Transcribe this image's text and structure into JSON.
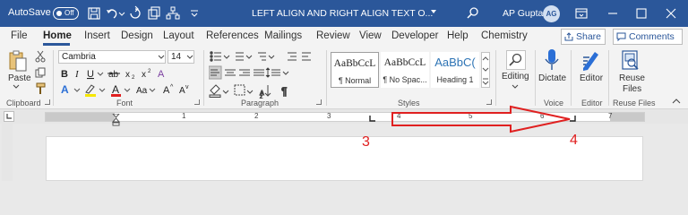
{
  "titlebar": {
    "autosave_label": "AutoSave",
    "autosave_state": "Off",
    "doc_title": "LEFT ALIGN AND RIGHT ALIGN TEXT O...",
    "user_name": "AP Gupta",
    "user_initials": "AG",
    "bar_color": "#2b579a"
  },
  "tabs": [
    "File",
    "Home",
    "Insert",
    "Design",
    "Layout",
    "References",
    "Mailings",
    "Review",
    "View",
    "Developer",
    "Help",
    "Chemistry"
  ],
  "active_tab": "Home",
  "share_label": "Share",
  "comments_label": "Comments",
  "clipboard": {
    "paste_label": "Paste",
    "group_label": "Clipboard"
  },
  "font": {
    "name": "Cambria",
    "size": "14",
    "group_label": "Font"
  },
  "paragraph": {
    "group_label": "Paragraph"
  },
  "styles": {
    "group_label": "Styles",
    "items": [
      {
        "sample": "AaBbCcL",
        "name": "¶ Normal"
      },
      {
        "sample": "AaBbCcL",
        "name": "¶ No Spac..."
      },
      {
        "sample": "AaBbC(",
        "name": "Heading 1"
      }
    ]
  },
  "editing": {
    "label": "Editing"
  },
  "voice": {
    "dictate_label": "Dictate",
    "group_label": "Voice"
  },
  "editor": {
    "label": "Editor",
    "group_label": "Editor"
  },
  "reuse": {
    "label_line1": "Reuse",
    "label_line2": "Files",
    "group_label": "Reuse Files"
  },
  "ruler": {
    "numbers": [
      "1",
      "2",
      "3",
      "4",
      "5",
      "6",
      "7"
    ]
  },
  "annotations": {
    "left_marker": "3",
    "right_marker": "4",
    "color": "#e02020"
  }
}
